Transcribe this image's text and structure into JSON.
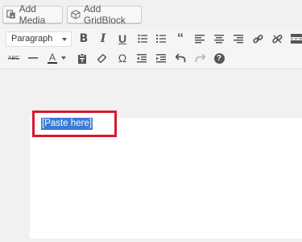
{
  "media_buttons": {
    "add_media": "Add Media",
    "add_gridblock": "Add GridBlock"
  },
  "toolbar": {
    "format_select": "Paragraph",
    "row1_icons": [
      "bold-icon",
      "italic-icon",
      "underline-icon",
      "bullet-list-icon",
      "numbered-list-icon",
      "blockquote-icon",
      "align-left-icon",
      "align-center-icon",
      "align-right-icon",
      "insert-link-icon",
      "remove-link-icon",
      "read-more-icon"
    ],
    "row2_icons": [
      "strikethrough-icon",
      "horizontal-line-icon",
      "text-color-icon",
      "text-color-dropdown-icon",
      "paste-as-text-icon",
      "clear-formatting-icon",
      "special-character-icon",
      "outdent-icon",
      "indent-icon",
      "undo-icon",
      "redo-icon",
      "help-icon"
    ]
  },
  "editor": {
    "selected_text": "[Paste here]"
  },
  "colors": {
    "highlight": "#3b7ad6",
    "callout_border": "#d9182d"
  }
}
